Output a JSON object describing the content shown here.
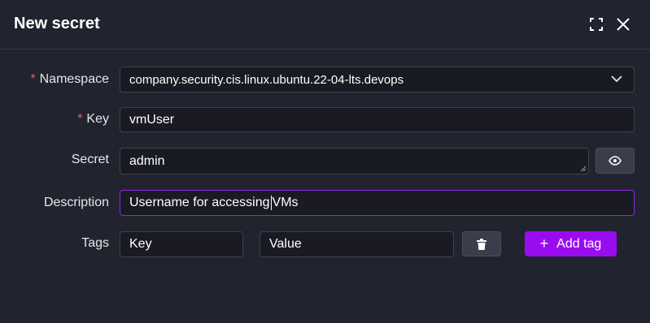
{
  "dialog": {
    "title": "New secret"
  },
  "icons": {
    "expand": "expand-icon",
    "close": "close-icon",
    "chevron": "chevron-down-icon",
    "eye": "eye-icon",
    "trash": "trash-icon",
    "plus": "plus-icon"
  },
  "form": {
    "namespace": {
      "label": "Namespace",
      "required": "*",
      "value": "company.security.cis.linux.ubuntu.22-04-lts.devops"
    },
    "key": {
      "label": "Key",
      "required": "*",
      "value": "vmUser"
    },
    "secret": {
      "label": "Secret",
      "value": "admin"
    },
    "description": {
      "label": "Description",
      "value_before_caret": "Username for accessing",
      "value_after_caret": "VMs"
    },
    "tags": {
      "label": "Tags",
      "key_placeholder": "Key",
      "value_placeholder": "Value",
      "add_label": "Add tag"
    }
  },
  "colors": {
    "accent": "#9a0cf0",
    "required": "#e25d5d",
    "focus_border": "#8a2be2",
    "background": "#21242f",
    "input_bg": "#191a22"
  }
}
